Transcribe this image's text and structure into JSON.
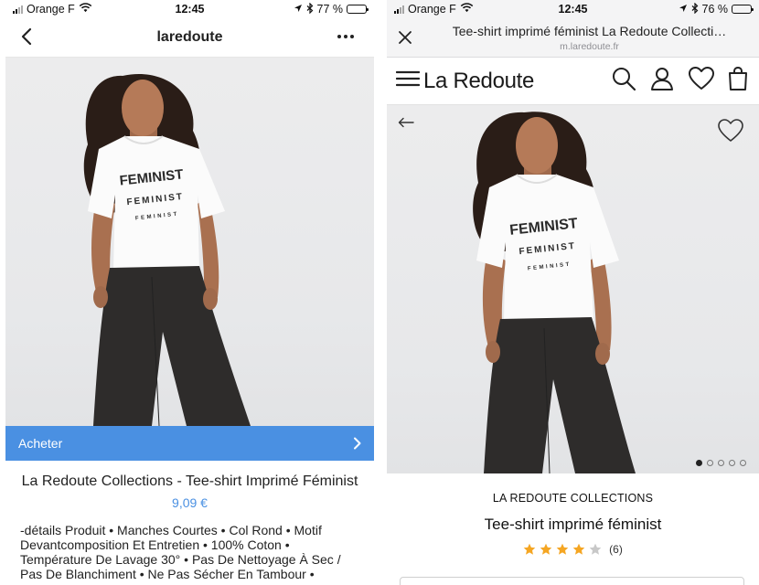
{
  "left": {
    "status": {
      "carrier": "Orange F",
      "time": "12:45",
      "battery": "77 %",
      "battery_level": 0.77
    },
    "header": {
      "title": "laredoute"
    },
    "cta": {
      "label": "Acheter"
    },
    "product": {
      "title": "La Redoute Collections - Tee-shirt Imprimé Féminist",
      "price": "9,09 €",
      "description": "-détails Produit • Manches Courtes • Col Rond • Motif Devantcomposition Et Entretien • 100% Coton • Température De Lavage 30° • Pas De Nettoyage À Sec / Pas De Blanchiment • Ne Pas Sécher En Tambour •"
    }
  },
  "right": {
    "status": {
      "carrier": "Orange F",
      "time": "12:45",
      "battery": "76 %",
      "battery_level": 0.76
    },
    "browser": {
      "title": "Tee-shirt imprimé féminist La Redoute Collecti…",
      "url": "m.laredoute.fr"
    },
    "site": {
      "logo": "La Redoute"
    },
    "gallery": {
      "slides": 5,
      "active": 1
    },
    "product": {
      "brand": "LA REDOUTE COLLECTIONS",
      "name": "Tee-shirt imprimé féminist",
      "rating": 4,
      "rating_max": 5,
      "review_count": "(6)"
    }
  },
  "shirt_print": [
    "FEMINIST",
    "FEMINIST",
    "FEMINIST"
  ],
  "colors": {
    "accent": "#4a90e2",
    "star": "#f5a623",
    "star_empty": "#c8c8c8"
  }
}
